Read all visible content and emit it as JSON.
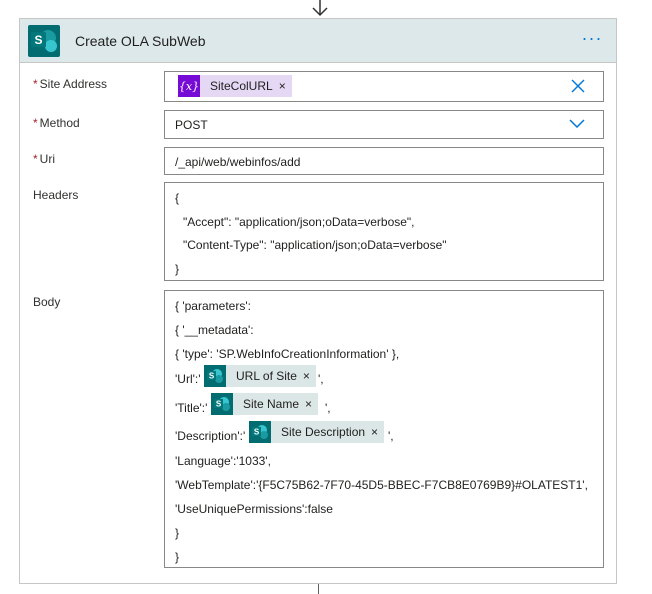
{
  "action": {
    "title": "Create OLA SubWeb",
    "more_label": "···"
  },
  "site_address": {
    "label": "Site Address",
    "required_marker": "*",
    "token": {
      "label": "SiteColURL",
      "icon": "variable-icon",
      "remove": "×"
    }
  },
  "method": {
    "label": "Method",
    "required_marker": "*",
    "value": "POST"
  },
  "uri": {
    "label": "Uri",
    "required_marker": "*",
    "value": "/_api/web/webinfos/add"
  },
  "headers": {
    "label": "Headers",
    "lines": [
      "{",
      "\"Accept\": \"application/json;oData=verbose\",",
      "\"Content-Type\": \"application/json;oData=verbose\"",
      "}"
    ]
  },
  "body": {
    "label": "Body",
    "lines": {
      "l1": "{ 'parameters':",
      "l2": "{ '__metadata':",
      "l3": "{ 'type': 'SP.WebInfoCreationInformation' },",
      "l4_prefix": "'Url':'",
      "l4_suffix": "',",
      "l5_prefix": "'Title':'",
      "l5_suffix": "',",
      "l6_prefix": "'Description':'",
      "l6_suffix": "',",
      "l7": "'Language':'1033',",
      "l8": "'WebTemplate':'{F5C75B62-7F70-45D5-BBEC-F7CB8E0769B9}#OLATEST1',",
      "l9": "'UseUniquePermissions':false",
      "l10": "}",
      "l11": "}"
    },
    "tokens": {
      "url": {
        "label": "URL of Site",
        "remove": "×"
      },
      "title": {
        "label": "Site Name",
        "remove": "×"
      },
      "description": {
        "label": "Site Description",
        "remove": "×"
      }
    }
  },
  "colors": {
    "header_bg": "#dde8ea",
    "sharepoint_teal": "#036c70",
    "variable_purple": "#770bd6",
    "accent_blue": "#0078d4",
    "required_red": "#a4262c"
  }
}
